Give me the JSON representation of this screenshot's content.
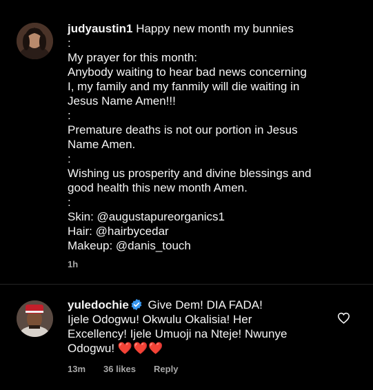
{
  "post": {
    "username": "judyaustin1",
    "caption_lines": [
      "Happy new month my bunnies",
      ":",
      "My prayer for this month:",
      "Anybody waiting to hear bad news concerning",
      "I, my family and my fanmily will die waiting in",
      "Jesus Name Amen!!!",
      ":",
      "Premature deaths is not our portion in Jesus",
      "Name Amen.",
      ":",
      "Wishing us prosperity and divine blessings and",
      "good health this new month Amen.",
      ":",
      "Skin: @augustapureorganics1",
      "Hair: @hairbycedar",
      "Makeup: @danis_touch"
    ],
    "time": "1h",
    "avatar_icon": "profile-photo-icon"
  },
  "comment": {
    "username": "yuledochie",
    "verified": true,
    "text_lines": [
      "Give Dem! DIA FADA!",
      "Ijele Odogwu! Okwulu Okalisia! Her",
      "Excellency! Ijele Umuoji na Nteje! Nwunye",
      "Odogwu!"
    ],
    "hearts": "❤️❤️❤️",
    "time": "13m",
    "likes": "36 likes",
    "reply_label": "Reply",
    "like_icon": "heart-outline-icon"
  },
  "colors": {
    "background": "#000000",
    "text": "#f5f5f5",
    "secondary": "#a8a8a8",
    "verified": "#3897f0",
    "heart": "#e8212f"
  }
}
